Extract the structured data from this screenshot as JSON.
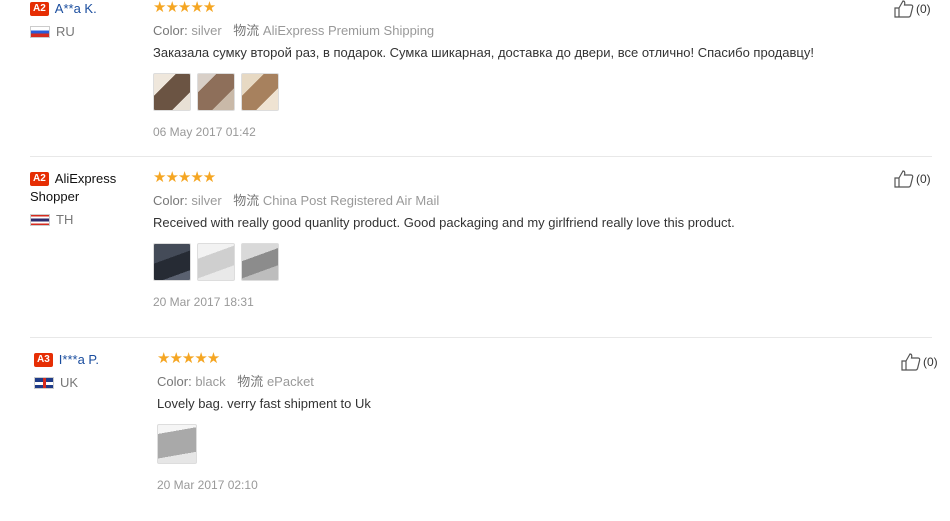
{
  "reviews": [
    {
      "level": "A2",
      "user": "A**a K.",
      "user_line2": "",
      "country": "RU",
      "stars": "★★★★★",
      "color_label": "Color:",
      "color_value": "silver",
      "ship_label": "物流",
      "ship_value": "AliExpress Premium Shipping",
      "text": "Заказала сумку второй раз, в подарок. Сумка шикарная, доставка до двери, все отлично! Спасибо продавцу!",
      "date": "06 May 2017 01:42",
      "helpful": "(0)",
      "photos": [
        "bag-photo-1",
        "bag-photo-2",
        "bag-photo-3"
      ]
    },
    {
      "level": "A2",
      "user": "AliExpress",
      "user_line2": "Shopper",
      "country": "TH",
      "stars": "★★★★★",
      "color_label": "Color:",
      "color_value": "silver",
      "ship_label": "物流",
      "ship_value": "China Post Registered Air Mail",
      "text": "Received with really good quanlity product. Good packaging and my girlfriend really love this product.",
      "date": "20 Mar 2017 18:31",
      "helpful": "(0)",
      "photos": [
        "bag-photo-1",
        "bag-photo-2",
        "bag-photo-3"
      ]
    },
    {
      "level": "A3",
      "user": "I***a P.",
      "user_line2": "",
      "country": "UK",
      "stars": "★★★★★",
      "color_label": "Color:",
      "color_value": "black",
      "ship_label": "物流",
      "ship_value": "ePacket",
      "text": "Lovely bag. verry fast shipment to Uk",
      "date": "20 Mar 2017 02:10",
      "helpful": "(0)",
      "photos": [
        "bag-photo-1"
      ]
    }
  ],
  "colors": {
    "star": "#f5a623",
    "level_badge": "#e62e04",
    "username": "#1a4d9e"
  }
}
